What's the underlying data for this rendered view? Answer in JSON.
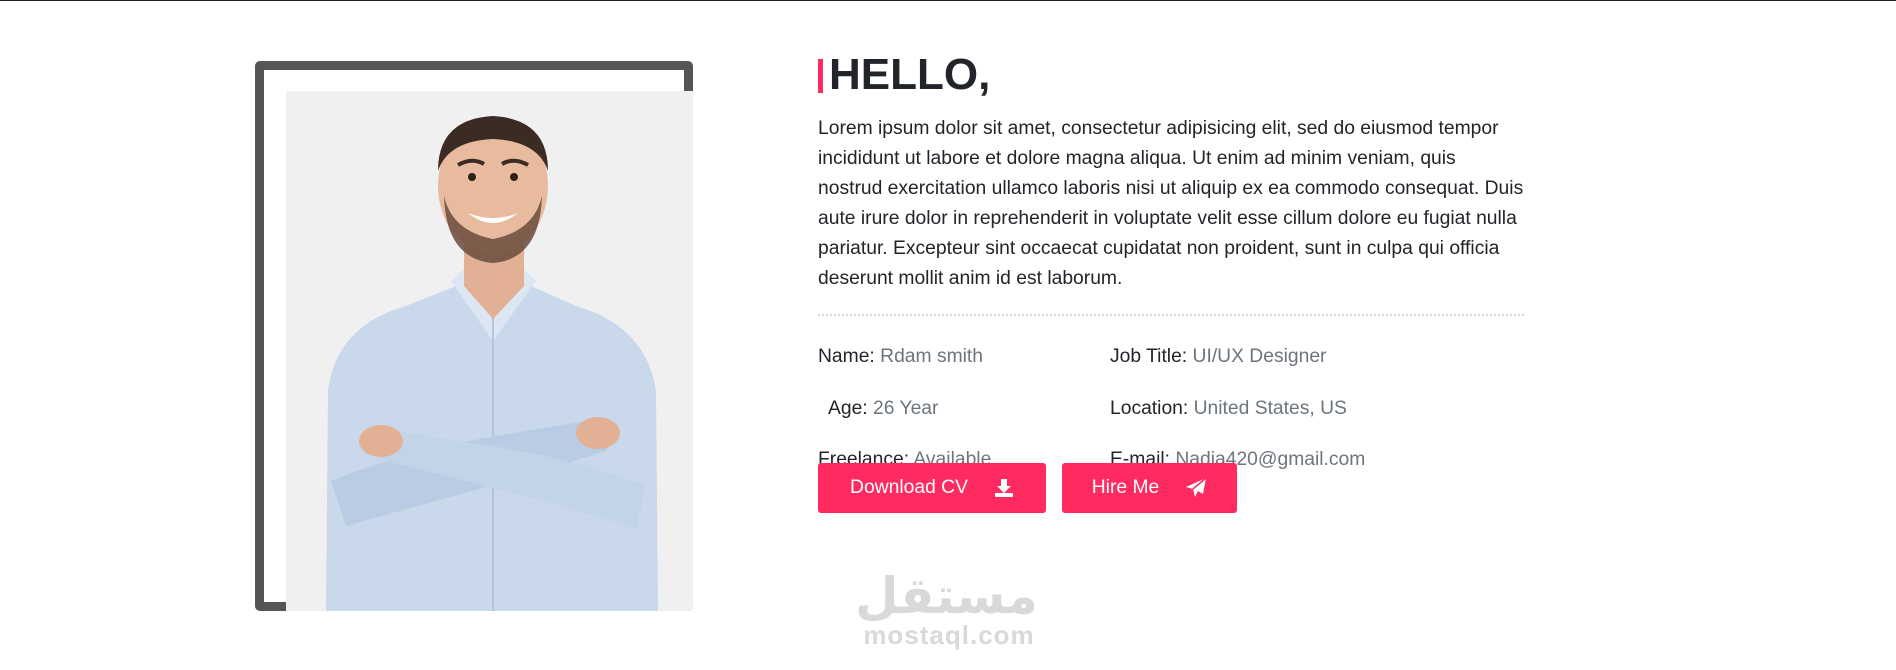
{
  "hero": {
    "greeting": "HELLO,",
    "intro": "Lorem ipsum dolor sit amet, consectetur adipisicing elit, sed do eiusmod tempor incididunt ut labore et dolore magna aliqua. Ut enim ad minim veniam, quis nostrud exercitation ullamco laboris nisi ut aliquip ex ea commodo consequat. Duis aute irure dolor in reprehenderit in voluptate velit esse cillum dolore eu fugiat nulla pariatur. Excepteur sint occaecat cupidatat non proident, sunt in culpa qui officia deserunt mollit anim id est laborum."
  },
  "info": {
    "name": {
      "label": "Name:",
      "value": "Rdam smith"
    },
    "job_title": {
      "label": "Job Title:",
      "value": "UI/UX Designer"
    },
    "age": {
      "label": "Age:",
      "value": "26 Year"
    },
    "location": {
      "label": "Location:",
      "value": "United States, US"
    },
    "freelance": {
      "label": "Freelance:",
      "value": "Available"
    },
    "email": {
      "label": "E-mail:",
      "value": "Nadia420@gmail.com"
    }
  },
  "buttons": {
    "download_cv": {
      "label": "Download CV",
      "icon": "download-icon"
    },
    "hire_me": {
      "label": "Hire Me",
      "icon": "paper-plane-icon"
    }
  },
  "watermark": {
    "arabic": "مستقل",
    "latin": "mostaql.com"
  },
  "colors": {
    "accent": "#ff2a5f",
    "frame": "#555555",
    "muted_text": "#6c757d",
    "photo_bg": "#f0f0f0"
  }
}
